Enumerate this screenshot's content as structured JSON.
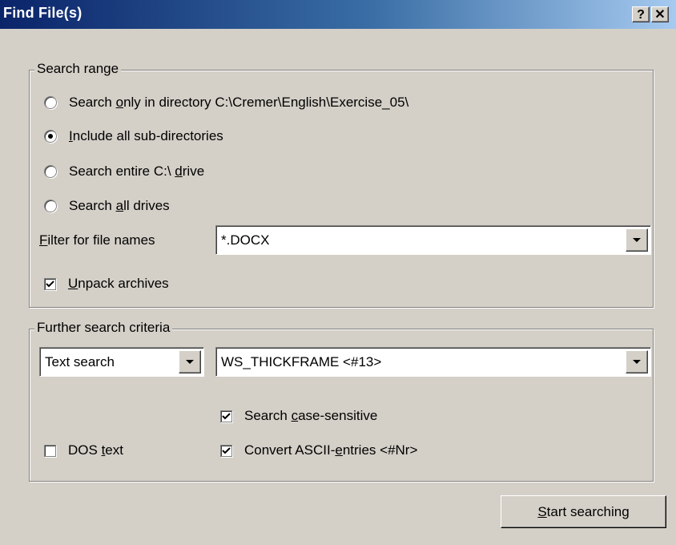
{
  "window": {
    "title": "Find File(s)",
    "help_label": "?",
    "close_label": "✕"
  },
  "search_range": {
    "legend": "Search range",
    "options": [
      {
        "pre": "Search ",
        "key": "o",
        "post": "nly in directory C:\\Cremer\\English\\Exercise_05\\",
        "selected": false
      },
      {
        "pre": "",
        "key": "I",
        "post": "nclude all sub-directories",
        "selected": true
      },
      {
        "pre": "Search entire C:\\ ",
        "key": "d",
        "post": "rive",
        "selected": false
      },
      {
        "pre": "Search ",
        "key": "a",
        "post": "ll drives",
        "selected": false
      }
    ],
    "filter_label_key": "F",
    "filter_label_rest": "ilter for file names",
    "filter_value": "*.DOCX",
    "unpack_key": "U",
    "unpack_rest": "npack archives",
    "unpack_checked": true
  },
  "further": {
    "legend": "Further search criteria",
    "type_value": "Text search",
    "text_value": "WS_THICKFRAME <#13>",
    "case_pre": "Search ",
    "case_key": "c",
    "case_post": "ase-sensitive",
    "case_checked": true,
    "dos_pre": "DOS ",
    "dos_key": "t",
    "dos_post": "ext",
    "dos_checked": false,
    "ascii_pre": "Convert ASCII-",
    "ascii_key": "e",
    "ascii_post": "ntries <#Nr>",
    "ascii_checked": true
  },
  "start_button": {
    "key": "S",
    "rest": "tart searching"
  }
}
